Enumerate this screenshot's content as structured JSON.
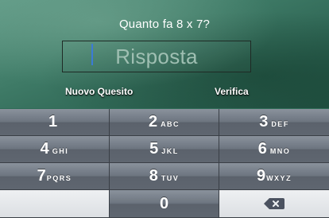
{
  "question": "Quanto fa 8 x 7?",
  "answer": {
    "value": "",
    "placeholder": "Risposta"
  },
  "actions": {
    "new_label": "Nuovo Quesito",
    "check_label": "Verifica"
  },
  "keypad": {
    "keys": [
      {
        "digit": "1",
        "letters": ""
      },
      {
        "digit": "2",
        "letters": "ABC"
      },
      {
        "digit": "3",
        "letters": "DEF"
      },
      {
        "digit": "4",
        "letters": "GHI"
      },
      {
        "digit": "5",
        "letters": "JKL"
      },
      {
        "digit": "6",
        "letters": "MNO"
      },
      {
        "digit": "7",
        "letters": "PQRS"
      },
      {
        "digit": "8",
        "letters": "TUV"
      },
      {
        "digit": "9",
        "letters": "WXYZ"
      },
      {
        "digit": "0",
        "letters": ""
      }
    ],
    "delete_icon": "backspace-icon"
  },
  "colors": {
    "board": "#3e7a66",
    "key_dark": "#6d7580",
    "key_light": "#dcdfe3",
    "cursor": "#3b7bd6"
  }
}
